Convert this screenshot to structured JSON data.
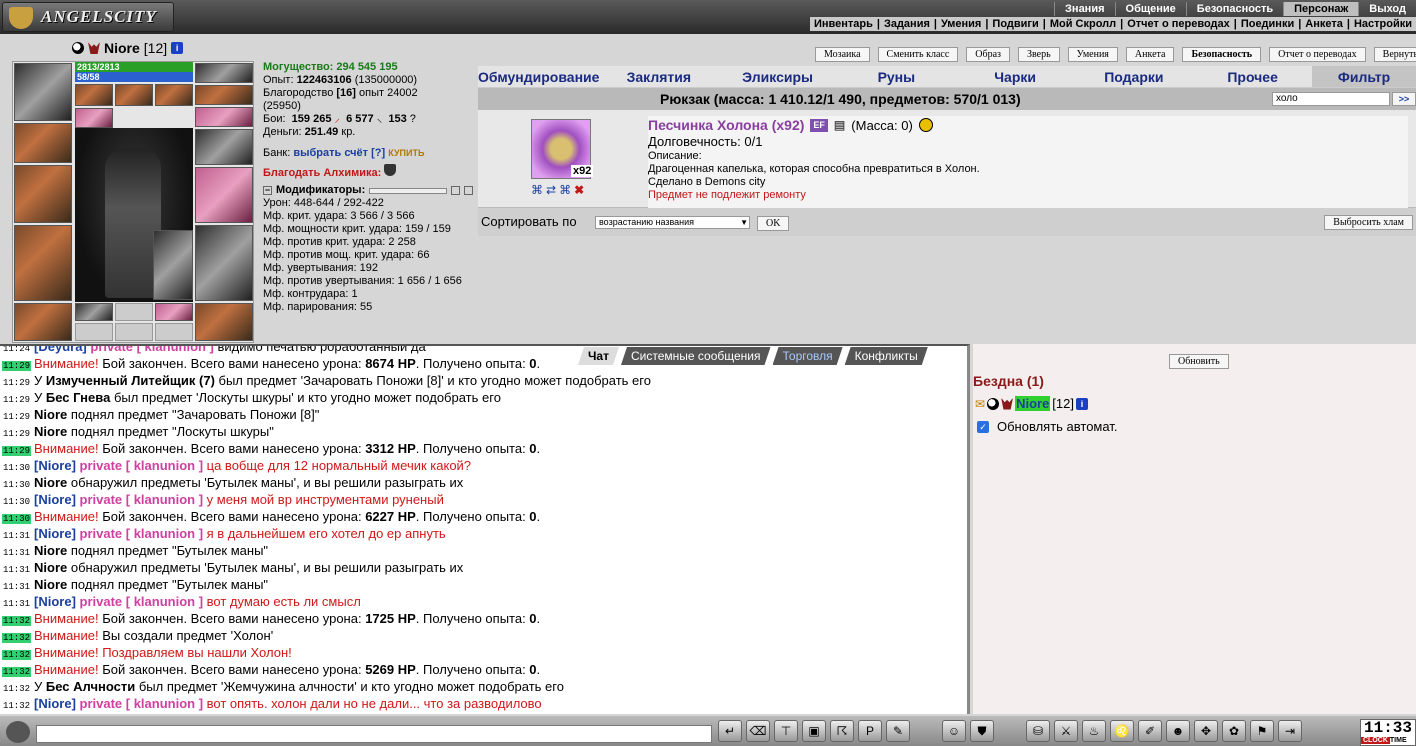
{
  "header": {
    "logo": "ANGELSCITY",
    "menu_top": [
      "Знания",
      "Общение",
      "Безопасность",
      "Персонаж",
      "Выход"
    ],
    "menu_top_active": "Персонаж",
    "menu_sub": [
      "Инвентарь",
      "Задания",
      "Умения",
      "Подвиги",
      "Мой Скролл",
      "Отчет о переводах",
      "Поединки",
      "Анкета",
      "Настройки"
    ]
  },
  "character": {
    "name": "Niore",
    "level": "[12]",
    "hp": "2813/2813",
    "mp": "58/58",
    "power_label": "Могущество:",
    "power": "294 545 195",
    "exp_label": "Опыт:",
    "exp": "122463106",
    "exp_next": "(135000000)",
    "blag_label": "Благородство",
    "blag_lvl": "[16]",
    "blag_exp": "опыт 24002",
    "blag_next": "(25950)",
    "fights_label": "Бои:",
    "wins": "159 265",
    "losses": "6 577",
    "draws": "153",
    "money_label": "Деньги:",
    "money": "251.49",
    "money_unit": "кр.",
    "bank_label": "Банк:",
    "bank_link": "выбрать счёт",
    "bank_help": "[?]",
    "buy": "КУПИТЬ",
    "alchemist": "Благодать Алхимика:",
    "mods_title": "Модификаторы:",
    "mods": [
      "Урон: 448-644 / 292-422",
      "Мф. крит. удара: 3 566 / 3 566",
      "Мф. мощности крит. удара: 159 / 159",
      "Мф. против крит. удара: 2 258",
      "Мф. против мощ. крит. удара: 66",
      "Мф. увертывания: 192",
      "Мф. против увертывания: 1 656 / 1 656",
      "Мф. контрудара: 1",
      "Мф. парирования: 55"
    ]
  },
  "buttons": [
    "Мозаика",
    "Сменить класс",
    "Образ",
    "Зверь",
    "Умения",
    "Анкета",
    "Безопасность",
    "Отчет о переводах",
    "Вернуться"
  ],
  "inventory": {
    "tabs": [
      "Обмундирование",
      "Заклятия",
      "Эликсиры",
      "Руны",
      "Чарки",
      "Подарки",
      "Прочее",
      "Фильтр"
    ],
    "active_tab": "Фильтр",
    "backpack": "Рюкзак (масса: 1 410.12/1 490, предметов: 570/1 013)",
    "search_value": "холо",
    "search_go": ">>",
    "item": {
      "name": "Песчинка Холона (x92)",
      "badge": "EF",
      "mass": "(Масса: 0)",
      "qty": "x92",
      "durability": "Долговечность: 0/1",
      "desc_label": "Описание:",
      "desc": "Драгоценная капелька, которая способна превратиться в Холон.",
      "made": "Сделано в Demons city",
      "norepair": "Предмет не подлежит ремонту"
    },
    "sort_label": "Сортировать по",
    "sort_value": "возрастанию названия",
    "ok": "OK",
    "drop_junk": "Выбросить хлам"
  },
  "chat": {
    "tabs": [
      "Чат",
      "Системные сообщения",
      "Торговля",
      "Конфликты"
    ],
    "active_tab": "Чат",
    "lines": [
      {
        "t": "11:24",
        "hl": false,
        "parts": [
          [
            "nk",
            "[Deydra] "
          ],
          [
            "pr",
            "private [ klanunion ] "
          ],
          [
            "",
            "видимо печатью роработанный да"
          ]
        ]
      },
      {
        "t": "11:29",
        "hl": true,
        "parts": [
          [
            "red",
            "Внимание! "
          ],
          [
            "",
            "Бой закончен. Всего вами нанесено урона: "
          ],
          [
            "b",
            "8674 HP"
          ],
          [
            "",
            ". Получено опыта: "
          ],
          [
            "b",
            "0"
          ],
          [
            "",
            "."
          ]
        ]
      },
      {
        "t": "11:29",
        "hl": false,
        "parts": [
          [
            "",
            "У "
          ],
          [
            "b",
            "Измученный Литейщик (7)"
          ],
          [
            "",
            " был предмет 'Зачаровать Поножи [8]' и кто угодно может подобрать его"
          ]
        ]
      },
      {
        "t": "11:29",
        "hl": false,
        "parts": [
          [
            "",
            "У "
          ],
          [
            "b",
            "Бес Гнева"
          ],
          [
            "",
            " был предмет 'Лоскуты шкуры' и кто угодно может подобрать его"
          ]
        ]
      },
      {
        "t": "11:29",
        "hl": false,
        "parts": [
          [
            "b",
            "Niore"
          ],
          [
            "",
            " поднял предмет \"Зачаровать Поножи [8]\""
          ]
        ]
      },
      {
        "t": "11:29",
        "hl": false,
        "parts": [
          [
            "b",
            "Niore"
          ],
          [
            "",
            " поднял предмет \"Лоскуты шкуры\""
          ]
        ]
      },
      {
        "t": "11:29",
        "hl": true,
        "parts": [
          [
            "red",
            "Внимание! "
          ],
          [
            "",
            "Бой закончен. Всего вами нанесено урона: "
          ],
          [
            "b",
            "3312 HP"
          ],
          [
            "",
            ". Получено опыта: "
          ],
          [
            "b",
            "0"
          ],
          [
            "",
            "."
          ]
        ]
      },
      {
        "t": "11:30",
        "hl": false,
        "parts": [
          [
            "nk",
            "[Niore] "
          ],
          [
            "pr",
            "private [ klanunion ] "
          ],
          [
            "red",
            "ца вобще для 12 нормальный мечик какой?"
          ]
        ]
      },
      {
        "t": "11:30",
        "hl": false,
        "parts": [
          [
            "b",
            "Niore"
          ],
          [
            "",
            " обнаружил предметы 'Бутылек маны', и вы решили разыграть их"
          ]
        ]
      },
      {
        "t": "11:30",
        "hl": false,
        "parts": [
          [
            "nk",
            "[Niore] "
          ],
          [
            "pr",
            "private [ klanunion ] "
          ],
          [
            "red",
            "у меня мой вр инструментами руненый"
          ]
        ]
      },
      {
        "t": "11:30",
        "hl": true,
        "parts": [
          [
            "red",
            "Внимание! "
          ],
          [
            "",
            "Бой закончен. Всего вами нанесено урона: "
          ],
          [
            "b",
            "6227 HP"
          ],
          [
            "",
            ". Получено опыта: "
          ],
          [
            "b",
            "0"
          ],
          [
            "",
            "."
          ]
        ]
      },
      {
        "t": "11:31",
        "hl": false,
        "parts": [
          [
            "nk",
            "[Niore] "
          ],
          [
            "pr",
            "private [ klanunion ] "
          ],
          [
            "red",
            "я в дальнейшем его хотел до ер апнуть"
          ]
        ]
      },
      {
        "t": "11:31",
        "hl": false,
        "parts": [
          [
            "b",
            "Niore"
          ],
          [
            "",
            " поднял предмет \"Бутылек маны\""
          ]
        ]
      },
      {
        "t": "11:31",
        "hl": false,
        "parts": [
          [
            "b",
            "Niore"
          ],
          [
            "",
            " обнаружил предметы 'Бутылек маны', и вы решили разыграть их"
          ]
        ]
      },
      {
        "t": "11:31",
        "hl": false,
        "parts": [
          [
            "b",
            "Niore"
          ],
          [
            "",
            " поднял предмет \"Бутылек маны\""
          ]
        ]
      },
      {
        "t": "11:31",
        "hl": false,
        "parts": [
          [
            "nk",
            "[Niore] "
          ],
          [
            "pr",
            "private [ klanunion ] "
          ],
          [
            "red",
            "вот думаю есть ли смысл"
          ]
        ]
      },
      {
        "t": "11:32",
        "hl": true,
        "parts": [
          [
            "red",
            "Внимание! "
          ],
          [
            "",
            "Бой закончен. Всего вами нанесено урона: "
          ],
          [
            "b",
            "1725 HP"
          ],
          [
            "",
            ". Получено опыта: "
          ],
          [
            "b",
            "0"
          ],
          [
            "",
            "."
          ]
        ]
      },
      {
        "t": "11:32",
        "hl": true,
        "parts": [
          [
            "red",
            "Внимание! "
          ],
          [
            "",
            "Вы создали предмет 'Холон'"
          ]
        ]
      },
      {
        "t": "11:32",
        "hl": true,
        "parts": [
          [
            "red",
            "Внимание! Поздравляем вы нашли Холон!"
          ]
        ]
      },
      {
        "t": "11:32",
        "hl": true,
        "parts": [
          [
            "red",
            "Внимание! "
          ],
          [
            "",
            "Бой закончен. Всего вами нанесено урона: "
          ],
          [
            "b",
            "5269 HP"
          ],
          [
            "",
            ". Получено опыта: "
          ],
          [
            "b",
            "0"
          ],
          [
            "",
            "."
          ]
        ]
      },
      {
        "t": "11:32",
        "hl": false,
        "parts": [
          [
            "",
            "У "
          ],
          [
            "b",
            "Бес Алчности"
          ],
          [
            "",
            " был предмет 'Жемчужина алчности' и кто угодно может подобрать его"
          ]
        ]
      },
      {
        "t": "11:32",
        "hl": false,
        "parts": [
          [
            "nk",
            "[Niore] "
          ],
          [
            "pr",
            "private [ klanunion ] "
          ],
          [
            "red",
            "вот опять. холон дали но не дали... что за разводилово"
          ]
        ]
      }
    ]
  },
  "online": {
    "refresh": "Обновить",
    "location": "Бездна (1)",
    "player": "Niore",
    "player_level": "[12]",
    "auto_refresh": "Обновлять автомат."
  },
  "clock": {
    "time": "11:33",
    "label_clock": "CLOCK",
    "label_time": "TIME"
  }
}
